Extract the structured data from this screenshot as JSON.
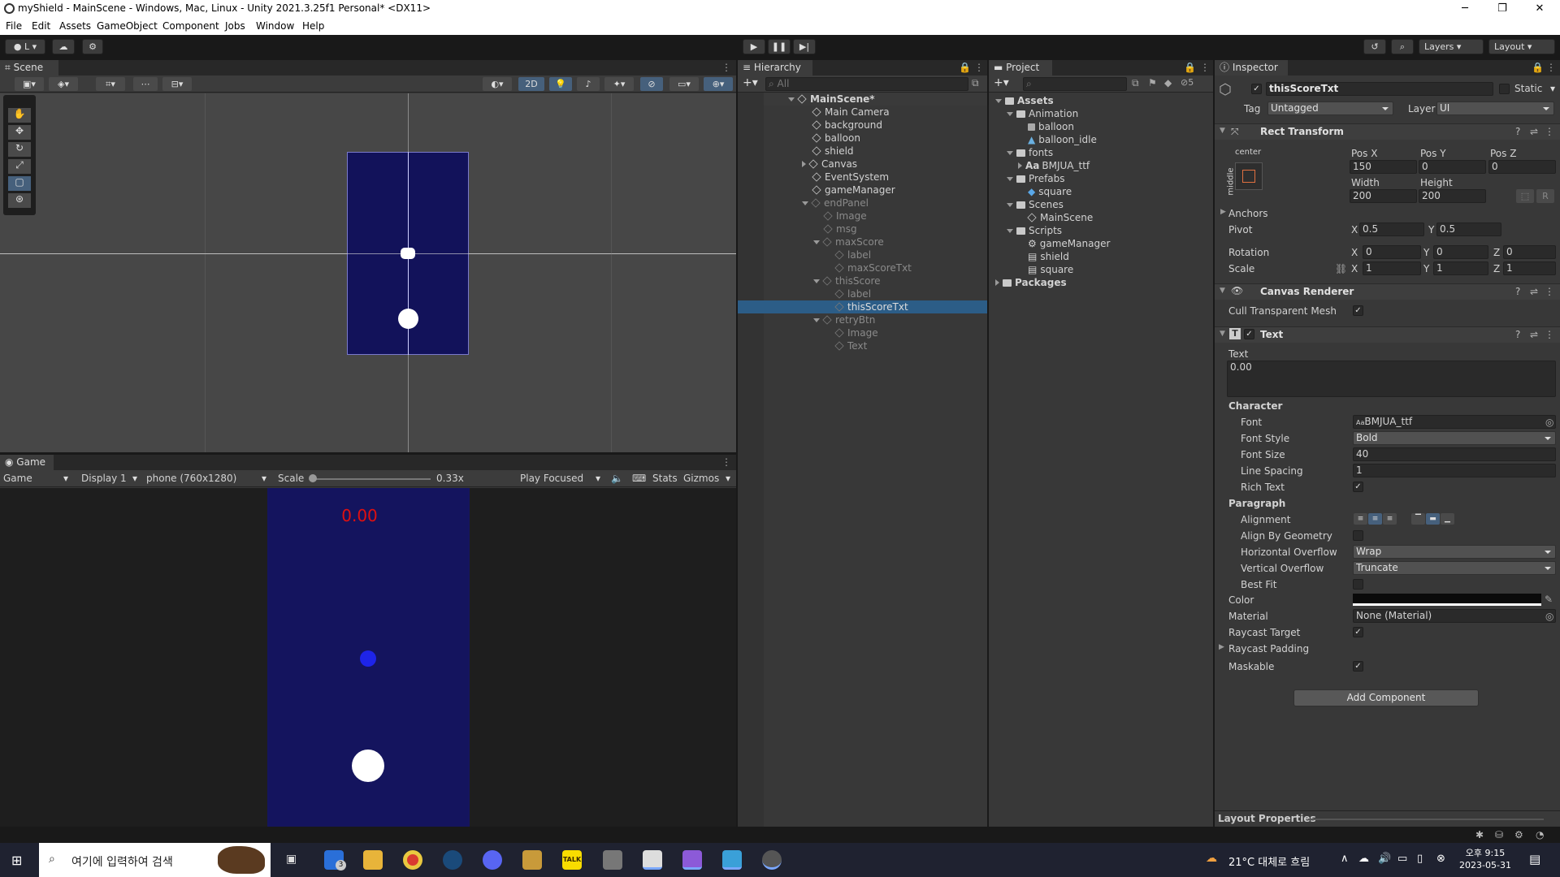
{
  "window": {
    "title": "myShield - MainScene - Windows, Mac, Linux - Unity 2021.3.25f1 Personal* <DX11>",
    "min": "─",
    "max": "❐",
    "close": "✕"
  },
  "menu": [
    "File",
    "Edit",
    "Assets",
    "GameObject",
    "Component",
    "Jobs",
    "Window",
    "Help"
  ],
  "toolbar": {
    "account": "L",
    "layers": "Layers",
    "layout": "Layout"
  },
  "scene": {
    "tab": "Scene",
    "mode2d": "2D"
  },
  "game": {
    "tab": "Game",
    "mode": "Game",
    "display": "Display 1",
    "resolution": "phone (760x1280)",
    "scale_label": "Scale",
    "scale_value": "0.33x",
    "play": "Play Focused",
    "stats": "Stats",
    "gizmos": "Gizmos",
    "score": "0.00"
  },
  "hierarchy": {
    "tab": "Hierarchy",
    "search": "All",
    "items": [
      {
        "label": "MainScene*"
      },
      {
        "label": "Main Camera"
      },
      {
        "label": "background"
      },
      {
        "label": "balloon"
      },
      {
        "label": "shield"
      },
      {
        "label": "Canvas"
      },
      {
        "label": "EventSystem"
      },
      {
        "label": "gameManager"
      },
      {
        "label": "endPanel"
      },
      {
        "label": "Image"
      },
      {
        "label": "msg"
      },
      {
        "label": "maxScore"
      },
      {
        "label": "label"
      },
      {
        "label": "maxScoreTxt"
      },
      {
        "label": "thisScore"
      },
      {
        "label": "label"
      },
      {
        "label": "thisScoreTxt"
      },
      {
        "label": "retryBtn"
      },
      {
        "label": "Image"
      },
      {
        "label": "Text"
      }
    ]
  },
  "project": {
    "tab": "Project",
    "hidden_count": "5",
    "items": [
      {
        "label": "Assets"
      },
      {
        "label": "Animation"
      },
      {
        "label": "balloon"
      },
      {
        "label": "balloon_idle"
      },
      {
        "label": "fonts"
      },
      {
        "label": "BMJUA_ttf"
      },
      {
        "label": "Prefabs"
      },
      {
        "label": "square"
      },
      {
        "label": "Scenes"
      },
      {
        "label": "MainScene"
      },
      {
        "label": "Scripts"
      },
      {
        "label": "gameManager"
      },
      {
        "label": "shield"
      },
      {
        "label": "square"
      },
      {
        "label": "Packages"
      }
    ]
  },
  "inspector": {
    "tab": "Inspector",
    "name": "thisScoreTxt",
    "static": "Static",
    "tag_label": "Tag",
    "tag": "Untagged",
    "layer_label": "Layer",
    "layer": "UI",
    "rect": {
      "title": "Rect Transform",
      "anchor_h": "center",
      "anchor_v": "middle",
      "posx_l": "Pos X",
      "posy_l": "Pos Y",
      "posz_l": "Pos Z",
      "posx": "150",
      "posy": "0",
      "posz": "0",
      "width_l": "Width",
      "height_l": "Height",
      "width": "200",
      "height": "200",
      "r_btn": "R",
      "anchors": "Anchors",
      "pivot": "Pivot",
      "pivot_x": "0.5",
      "pivot_y": "0.5",
      "rotation": "Rotation",
      "rot_x": "0",
      "rot_y": "0",
      "rot_z": "0",
      "scale": "Scale",
      "sc_x": "1",
      "sc_y": "1",
      "sc_z": "1",
      "x": "X",
      "y": "Y",
      "z": "Z"
    },
    "canvas_renderer": {
      "title": "Canvas Renderer",
      "cull": "Cull Transparent Mesh"
    },
    "text": {
      "title": "Text",
      "text_label": "Text",
      "text_value": "0.00",
      "character": "Character",
      "font_l": "Font",
      "font": "BMJUA_ttf",
      "font_prefix": "Aa",
      "style_l": "Font Style",
      "style": "Bold",
      "size_l": "Font Size",
      "size": "40",
      "spacing_l": "Line Spacing",
      "spacing": "1",
      "rich_l": "Rich Text",
      "paragraph": "Paragraph",
      "align_l": "Alignment",
      "geom_l": "Align By Geometry",
      "hover_l": "Horizontal Overflow",
      "hover": "Wrap",
      "vover_l": "Vertical Overflow",
      "vover": "Truncate",
      "bestfit_l": "Best Fit",
      "color_l": "Color",
      "material_l": "Material",
      "material": "None (Material)",
      "raycast_l": "Raycast Target",
      "padding_l": "Raycast Padding",
      "maskable_l": "Maskable"
    },
    "add_component": "Add Component",
    "layout_props": "Layout Properties"
  },
  "taskbar": {
    "search": "여기에 입력하여 검색",
    "weather": "21°C 대체로 흐림",
    "time": "오후 9:15",
    "date": "2023-05-31",
    "mail_badge": "3",
    "kakao": "TALK"
  }
}
